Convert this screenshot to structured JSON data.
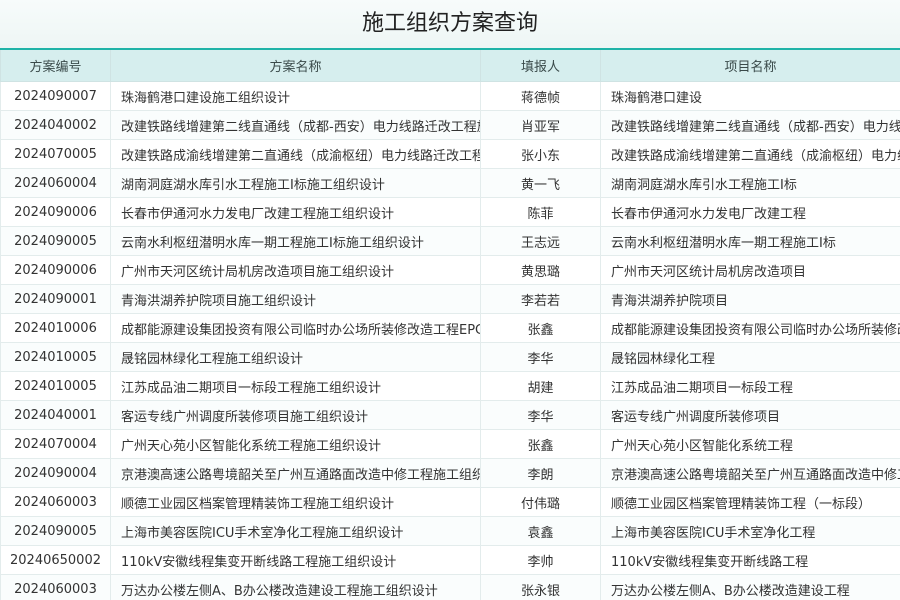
{
  "page": {
    "title": "施工组织方案查询"
  },
  "table": {
    "headers": [
      "方案编号",
      "方案名称",
      "填报人",
      "项目名称"
    ],
    "rows": [
      [
        "2024090007",
        "珠海鹤港口建设施工组织设计",
        "蒋德帧",
        "珠海鹤港口建设"
      ],
      [
        "2024040002",
        "改建铁路线增建第二线直通线（成都-西安）电力线路迁改工程施工组织设计",
        "肖亚军",
        "改建铁路线增建第二线直通线（成都-西安）电力线路迁改工程"
      ],
      [
        "2024070005",
        "改建铁路成渝线增建第二直通线（成渝枢纽）电力线路迁改工程施工组织设计",
        "张小东",
        "改建铁路成渝线增建第二直通线（成渝枢纽）电力线路迁改工程"
      ],
      [
        "2024060004",
        "湖南洞庭湖水库引水工程施工Ⅰ标施工组织设计",
        "黄一飞",
        "湖南洞庭湖水库引水工程施工Ⅰ标"
      ],
      [
        "2024090006",
        "长春市伊通河水力发电厂改建工程施工组织设计",
        "陈菲",
        "长春市伊通河水力发电厂改建工程"
      ],
      [
        "2024090005",
        "云南水利枢纽潜明水库一期工程施工Ⅰ标施工组织设计",
        "王志远",
        "云南水利枢纽潜明水库一期工程施工Ⅰ标"
      ],
      [
        "2024090006",
        "广州市天河区统计局机房改造项目施工组织设计",
        "黄思璐",
        "广州市天河区统计局机房改造项目"
      ],
      [
        "2024090001",
        "青海洪湖养护院项目施工组织设计",
        "李若若",
        "青海洪湖养护院项目"
      ],
      [
        "2024010006",
        "成都能源建设集团投资有限公司临时办公场所装修改造工程EPC施工组织设计",
        "张鑫",
        "成都能源建设集团投资有限公司临时办公场所装修改造工程"
      ],
      [
        "2024010005",
        "晟铭园林绿化工程施工组织设计",
        "李华",
        "晟铭园林绿化工程"
      ],
      [
        "2024010005",
        "江苏成品油二期项目一标段工程施工组织设计",
        "胡建",
        "江苏成品油二期项目一标段工程"
      ],
      [
        "2024040001",
        "客运专线广州调度所装修项目施工组织设计",
        "李华",
        "客运专线广州调度所装修项目"
      ],
      [
        "2024070004",
        "广州天心苑小区智能化系统工程施工组织设计",
        "张鑫",
        "广州天心苑小区智能化系统工程"
      ],
      [
        "2024090004",
        "京港澳高速公路粤境韶关至广州互通路面改造中修工程施工组织设计",
        "李朗",
        "京港澳高速公路粤境韶关至广州互通路面改造中修工程"
      ],
      [
        "2024060003",
        "顺德工业园区档案管理精装饰工程施工组织设计",
        "付伟璐",
        "顺德工业园区档案管理精装饰工程（一标段）"
      ],
      [
        "2024090005",
        "上海市美容医院ICU手术室净化工程施工组织设计",
        "袁鑫",
        "上海市美容医院ICU手术室净化工程"
      ],
      [
        "20240650002",
        "110kV安徽线程集变开断线路工程施工组织设计",
        "李帅",
        "110kV安徽线程集变开断线路工程"
      ],
      [
        "2024060003",
        "万达办公楼左侧A、B办公楼改造建设工程施工组织设计",
        "张永银",
        "万达办公楼左侧A、B办公楼改造建设工程"
      ]
    ]
  }
}
